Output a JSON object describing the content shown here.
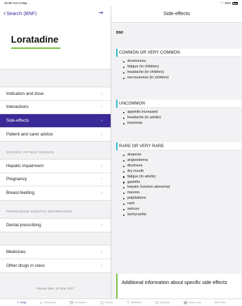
{
  "status": {
    "time": "10:59",
    "date": "Tue 5 May",
    "battery": "93%"
  },
  "nav": {
    "back_label": "Search (BNF)"
  },
  "drug": {
    "title": "Loratadine"
  },
  "sidebar": {
    "items": [
      {
        "label": "Indication and dose"
      },
      {
        "label": "Interactions"
      },
      {
        "label": "Side-effects"
      },
      {
        "label": "Patient and carer advice"
      }
    ],
    "patient_groups_label": "SPECIFIC PATIENT GROUPS",
    "patient_groups": [
      {
        "label": "Hepatic impairment"
      },
      {
        "label": "Pregnancy"
      },
      {
        "label": "Breast-feeding"
      }
    ],
    "profession_label": "PROFESSION-SPECIFIC INFORMATION",
    "profession_items": [
      {
        "label": "Dental prescribing"
      }
    ],
    "other_items": [
      {
        "label": "Medicines"
      },
      {
        "label": "Other drugs in class"
      }
    ],
    "review_date": "Review date: 22 May 2017"
  },
  "header": {
    "title": "Side-effects"
  },
  "content": {
    "source": "BNF",
    "sections": [
      {
        "heading": "COMMON OR VERY COMMON",
        "items": [
          "drowsiness",
          "fatigue (in children)",
          "headache (in children)",
          "nervousness (in children)"
        ]
      },
      {
        "heading": "UNCOMMON",
        "items": [
          "appetite increased",
          "headache (in adults)",
          "insomnia"
        ]
      },
      {
        "heading": "RARE OR VERY RARE",
        "items": [
          "alopecia",
          "angioedema",
          "dizziness",
          "dry mouth",
          "fatigue (in adults)",
          "gastritis",
          "hepatic function abnormal",
          "nausea",
          "palpitations",
          "rash",
          "seizure",
          "tachycardia"
        ]
      }
    ],
    "additional": "Additional information about specific side effects"
  },
  "tabs": [
    {
      "label": "Drugs",
      "icon": "pill-icon"
    },
    {
      "label": "Interactions",
      "icon": "interactions-icon"
    },
    {
      "label": "Summaries",
      "icon": "summaries-icon"
    },
    {
      "label": "Devices",
      "icon": "devices-icon"
    },
    {
      "label": "Borderline",
      "icon": "borderline-icon"
    },
    {
      "label": "Guidance",
      "icon": "guidance-icon"
    },
    {
      "label": "Wound care",
      "icon": "wound-care-icon"
    },
    {
      "label": "More",
      "icon": "more-icon"
    }
  ],
  "colors": {
    "accent": "#3a2a97",
    "green": "#7cc242",
    "teal": "#2bb8c8"
  }
}
